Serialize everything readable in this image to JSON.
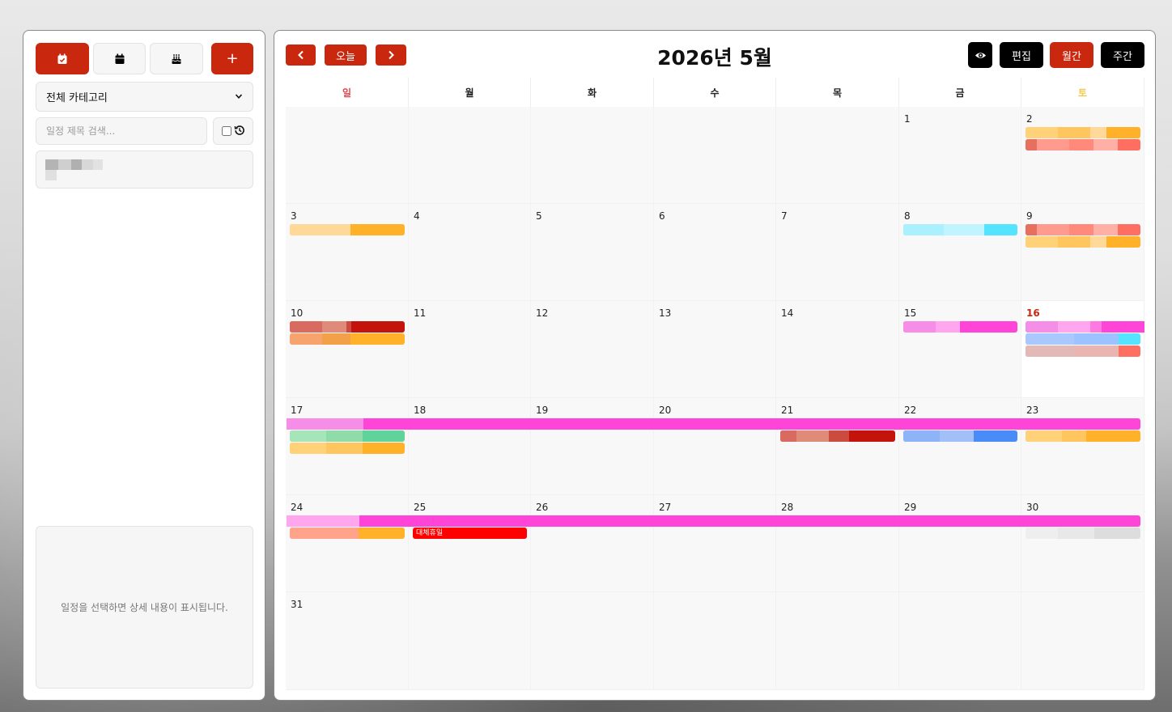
{
  "sidebar": {
    "buttons": [
      {
        "icon": "calendar-check-icon"
      },
      {
        "icon": "calendar-icon"
      },
      {
        "icon": "birthday-cake-icon"
      },
      {
        "icon": "plus-icon",
        "label": "+"
      }
    ],
    "category_select": "전체 카테고리",
    "search": {
      "placeholder": "일정 제목 검색..."
    },
    "history_icon": "history-icon",
    "detail_placeholder": "일정을 선택하면 상세 내용이 표시됩니다."
  },
  "calendar": {
    "title": "2026년 5월",
    "nav": {
      "prev_icon": "chevron-left-icon",
      "today": "오늘",
      "next_icon": "chevron-right-icon"
    },
    "toolbar": {
      "view_icon": "eye-icon",
      "edit": "편집",
      "month": "월간",
      "week": "주간"
    },
    "weekdays": [
      "일",
      "월",
      "화",
      "수",
      "목",
      "금",
      "토"
    ],
    "weekday_colors": {
      "sunday": "#e0474c",
      "saturday": "#f2c94c",
      "default": "#222222"
    },
    "selected_date": "16",
    "holiday_label": "대체휴일",
    "weeks": [
      [
        "",
        "",
        "",
        "",
        "",
        "1",
        "2"
      ],
      [
        "3",
        "4",
        "5",
        "6",
        "7",
        "8",
        "9"
      ],
      [
        "10",
        "11",
        "12",
        "13",
        "14",
        "15",
        "16"
      ],
      [
        "17",
        "18",
        "19",
        "20",
        "21",
        "22",
        "23"
      ],
      [
        "24",
        "25",
        "26",
        "27",
        "28",
        "29",
        "30"
      ],
      [
        "31",
        "",
        "",
        "",
        "",
        "",
        ""
      ]
    ]
  },
  "colors": {
    "accent_red": "#c9270e",
    "event_orange": "#ffb12a",
    "event_salmon": "#ff6f61",
    "event_cyan": "#55e4ff",
    "event_magenta": "#ff44d8",
    "event_darkred": "#c4130b",
    "event_blue": "#4a8cf7",
    "event_green": "#5fd39a",
    "event_gray": "#dddddd",
    "holiday_red": "#ff0000"
  }
}
